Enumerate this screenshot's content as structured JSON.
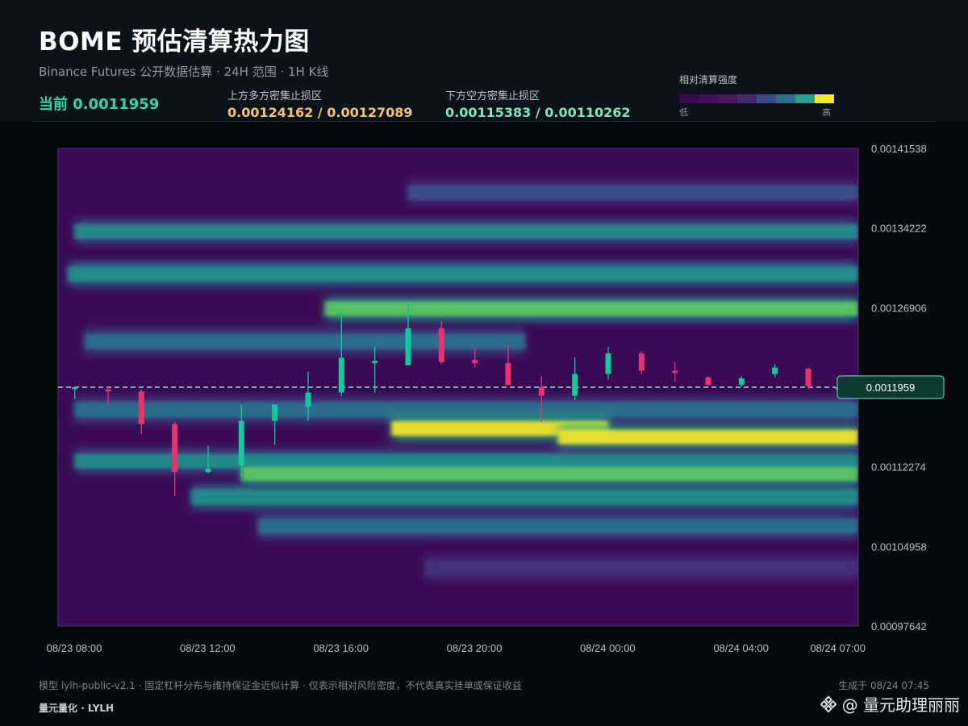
{
  "header": {
    "title": "BOME 预估清算热力图",
    "subtitle": "Binance Futures 公开数据估算 · 24H 范围 · 1H K线",
    "current_label": "当前 0.0011959",
    "upper_zone_label": "上方多方密集止损区",
    "upper_zone_value": "0.00124162 / 0.00127089",
    "lower_zone_label": "下方空方密集止损区",
    "lower_zone_value": "0.00115383 / 0.00110262"
  },
  "legend": {
    "title": "相对清算强度",
    "low": "低",
    "high": "高",
    "colors": [
      "#3b0a55",
      "#400f5e",
      "#44195f",
      "#452a72",
      "#3c4a8a",
      "#2c6f8e",
      "#2a9d8a",
      "#fde725"
    ]
  },
  "chart_data": {
    "type": "heatmap",
    "x_ticks": [
      "08/23 08:00",
      "08/23 12:00",
      "08/23 16:00",
      "08/23 20:00",
      "08/24 00:00",
      "08/24 04:00",
      "08/24 07:00"
    ],
    "y_ticks": [
      "0.00141538",
      "0.00134222",
      "0.00126906",
      "0.00112274",
      "0.00104958",
      "0.00097642"
    ],
    "ylim": [
      0.00097642,
      0.00141538
    ],
    "x_hours": [
      0,
      24
    ],
    "current_price": 0.0011959,
    "current_price_label": "0.0011959",
    "colors": {
      "up": "#12c99b",
      "down": "#e8336f",
      "current_line": "#7fe3d0"
    },
    "heat_bands": [
      {
        "price": 0.001375,
        "start": 10.5,
        "end": 24,
        "weight": 0.28
      },
      {
        "price": 0.001339,
        "start": 0.5,
        "end": 24,
        "weight": 0.45
      },
      {
        "price": 0.0013,
        "start": 0.3,
        "end": 24,
        "weight": 0.55
      },
      {
        "price": 0.001268,
        "start": 8.0,
        "end": 24,
        "weight": 0.78
      },
      {
        "price": 0.001238,
        "start": 0.8,
        "end": 14.0,
        "weight": 0.4
      },
      {
        "price": 0.001175,
        "start": 0.5,
        "end": 24,
        "weight": 0.42
      },
      {
        "price": 0.001158,
        "start": 10.0,
        "end": 16.5,
        "weight": 1.0
      },
      {
        "price": 0.00115,
        "start": 15.0,
        "end": 24,
        "weight": 1.0
      },
      {
        "price": 0.001128,
        "start": 0.5,
        "end": 24,
        "weight": 0.48
      },
      {
        "price": 0.001116,
        "start": 5.5,
        "end": 24,
        "weight": 0.72
      },
      {
        "price": 0.001095,
        "start": 4.0,
        "end": 24,
        "weight": 0.55
      },
      {
        "price": 0.001068,
        "start": 6.0,
        "end": 24,
        "weight": 0.4
      },
      {
        "price": 0.00103,
        "start": 11.0,
        "end": 24,
        "weight": 0.18
      }
    ],
    "candles": [
      {
        "t": 0.5,
        "o": 0.0011959,
        "h": 0.0011959,
        "l": 0.001185,
        "c": 0.0011959
      },
      {
        "t": 1.5,
        "o": 0.001194,
        "h": 0.0011959,
        "l": 0.00118,
        "c": 0.001192
      },
      {
        "t": 2.5,
        "o": 0.001192,
        "h": 0.001194,
        "l": 0.001153,
        "c": 0.001162
      },
      {
        "t": 3.5,
        "o": 0.001162,
        "h": 0.001164,
        "l": 0.001096,
        "c": 0.001118
      },
      {
        "t": 4.5,
        "o": 0.001118,
        "h": 0.001142,
        "l": 0.001117,
        "c": 0.001121
      },
      {
        "t": 5.5,
        "o": 0.001124,
        "h": 0.00118,
        "l": 0.001114,
        "c": 0.001165
      },
      {
        "t": 6.5,
        "o": 0.001165,
        "h": 0.00118,
        "l": 0.001143,
        "c": 0.00118
      },
      {
        "t": 7.5,
        "o": 0.001178,
        "h": 0.00121,
        "l": 0.001165,
        "c": 0.001191
      },
      {
        "t": 8.5,
        "o": 0.001191,
        "h": 0.001268,
        "l": 0.001188,
        "c": 0.001223
      },
      {
        "t": 9.5,
        "o": 0.001218,
        "h": 0.001233,
        "l": 0.001191,
        "c": 0.00122
      },
      {
        "t": 10.5,
        "o": 0.001216,
        "h": 0.001275,
        "l": 0.001216,
        "c": 0.00125
      },
      {
        "t": 11.5,
        "o": 0.00125,
        "h": 0.001257,
        "l": 0.001217,
        "c": 0.001219
      },
      {
        "t": 12.5,
        "o": 0.001221,
        "h": 0.001232,
        "l": 0.001214,
        "c": 0.001218
      },
      {
        "t": 13.5,
        "o": 0.001218,
        "h": 0.001235,
        "l": 0.001198,
        "c": 0.001198
      },
      {
        "t": 14.5,
        "o": 0.001196,
        "h": 0.001206,
        "l": 0.001164,
        "c": 0.001188
      },
      {
        "t": 15.5,
        "o": 0.001188,
        "h": 0.001223,
        "l": 0.001184,
        "c": 0.001208
      },
      {
        "t": 16.5,
        "o": 0.001208,
        "h": 0.001233,
        "l": 0.001203,
        "c": 0.001227
      },
      {
        "t": 17.5,
        "o": 0.001227,
        "h": 0.001229,
        "l": 0.001208,
        "c": 0.001211
      },
      {
        "t": 18.5,
        "o": 0.001211,
        "h": 0.001219,
        "l": 0.001201,
        "c": 0.001209
      },
      {
        "t": 19.5,
        "o": 0.001205,
        "h": 0.001206,
        "l": 0.001196,
        "c": 0.001198
      },
      {
        "t": 20.5,
        "o": 0.001198,
        "h": 0.001206,
        "l": 0.001196,
        "c": 0.001204
      },
      {
        "t": 21.5,
        "o": 0.001208,
        "h": 0.001217,
        "l": 0.001205,
        "c": 0.001214
      },
      {
        "t": 22.5,
        "o": 0.001213,
        "h": 0.001214,
        "l": 0.001194,
        "c": 0.001197
      },
      {
        "t": 23.4,
        "o": 0.001195,
        "h": 0.001196,
        "l": 0.001194,
        "c": 0.0011959
      }
    ]
  },
  "footer": {
    "note": "模型 lylh-public-v2.1 · 固定杠杆分布与维持保证金近似计算 · 仅表示相对风险密度，不代表真实挂单或保证收益",
    "brand": "量元量化 · LYLH",
    "generated": "生成于 08/24 07:45",
    "watermark": "@ 量元助理丽丽"
  }
}
